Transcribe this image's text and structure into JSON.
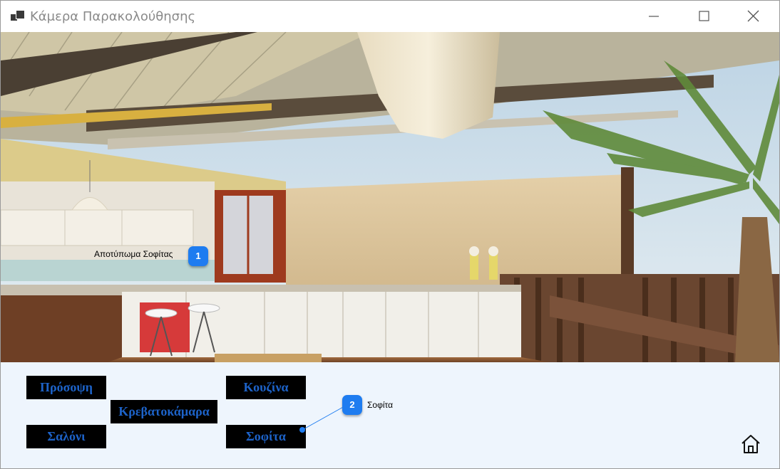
{
  "window": {
    "title": "Κάμερα Παρακολούθησης"
  },
  "camera": {
    "marker_1": {
      "number": "1",
      "label": "Αποτύπωμα Σοφίτας"
    },
    "marker_2": {
      "number": "2",
      "label": "Σοφίτα"
    }
  },
  "rooms": {
    "facade": "Πρόσοψη",
    "kitchen": "Κουζίνα",
    "bedroom": "Κρεβατοκάμαρα",
    "living_room": "Σαλόνι",
    "attic": "Σοφίτα"
  },
  "icons": {
    "app": "app-window-icon",
    "minimize": "minimize-icon",
    "maximize": "maximize-icon",
    "close": "close-icon",
    "home": "home-icon"
  },
  "colors": {
    "marker": "#1e7cf0",
    "button_bg": "#000000",
    "button_text": "#1d63c9",
    "panel_bg": "#eef5fd"
  }
}
